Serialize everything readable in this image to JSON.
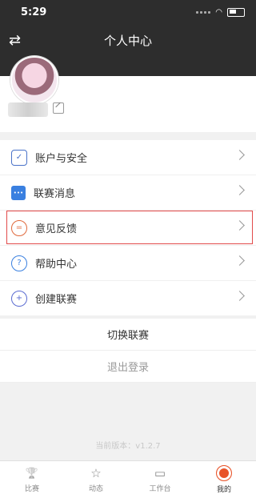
{
  "status": {
    "time": "5:29"
  },
  "header": {
    "title": "个人中心",
    "swap_icon": "⇄"
  },
  "menu": [
    {
      "label": "账户与安全",
      "icon": "shield-icon",
      "glyph": "✓",
      "color": "#4a73c9"
    },
    {
      "label": "联赛消息",
      "icon": "chat-icon",
      "glyph": "•••",
      "color": "#3a80e0"
    },
    {
      "label": "意见反馈",
      "icon": "feedback-icon",
      "glyph": "=",
      "color": "#e0693c"
    },
    {
      "label": "帮助中心",
      "icon": "help-icon",
      "glyph": "?",
      "color": "#3a80e0"
    },
    {
      "label": "创建联赛",
      "icon": "add-icon",
      "glyph": "+",
      "color": "#5a6bd1"
    }
  ],
  "actions": {
    "switch_league": "切换联赛",
    "logout": "退出登录"
  },
  "version": "当前版本：v1.2.7",
  "tabs": [
    {
      "label": "比赛",
      "icon": "trophy-icon",
      "glyph": "🏆"
    },
    {
      "label": "动态",
      "icon": "star-icon",
      "glyph": "☆"
    },
    {
      "label": "工作台",
      "icon": "monitor-icon",
      "glyph": "▭"
    },
    {
      "label": "我的",
      "icon": "profile-icon",
      "glyph": ""
    }
  ],
  "accent": "#e8542a"
}
